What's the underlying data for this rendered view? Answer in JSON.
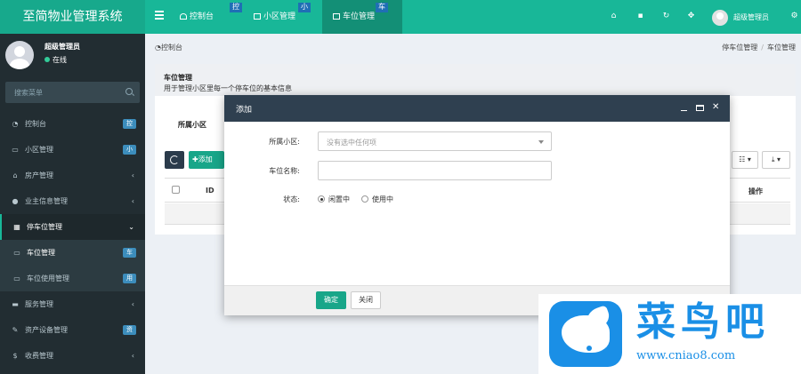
{
  "app_title": "至简物业管理系统",
  "top_tabs": [
    {
      "label": "控制台",
      "badge": "控",
      "icon": "dashboard-icon"
    },
    {
      "label": "小区管理",
      "badge": "小",
      "icon": "list-icon"
    },
    {
      "label": "车位管理",
      "badge": "车",
      "icon": "list-icon"
    }
  ],
  "top_user": "超级管理员",
  "top_icons": [
    "home-icon",
    "trash-icon",
    "refresh-icon",
    "fullscreen-icon",
    "settings-icon"
  ],
  "sidebar": {
    "user_name": "超级管理员",
    "status": "在线",
    "search_placeholder": "搜索菜单",
    "items": [
      {
        "label": "控制台",
        "badge": "控",
        "icon": "dashboard-icon"
      },
      {
        "label": "小区管理",
        "badge": "小",
        "icon": "list-icon"
      },
      {
        "label": "房产管理",
        "icon": "home-icon"
      },
      {
        "label": "业主信息管理",
        "icon": "user-icon"
      },
      {
        "label": "停车位管理",
        "icon": "parking-icon"
      },
      {
        "label": "车位管理",
        "badge": "车",
        "icon": "list-icon"
      },
      {
        "label": "车位使用管理",
        "badge": "用",
        "icon": "list-icon"
      },
      {
        "label": "服务管理",
        "icon": "book-icon"
      },
      {
        "label": "资产设备管理",
        "badge": "资",
        "icon": "wrench-icon"
      },
      {
        "label": "收费管理",
        "icon": "dollar-icon"
      }
    ]
  },
  "breadcrumb": {
    "left": "控制台",
    "right": [
      "停车位管理",
      "车位管理"
    ]
  },
  "panel": {
    "title": "车位管理",
    "desc": "用于管理小区里每一个停车位的基本信息",
    "tab_label": "所属小区",
    "add_label": "✚添加",
    "columns_btn": "☷ ▾",
    "export_btn": "⤓ ▾",
    "table_headers": {
      "id": "ID",
      "op": "操作"
    }
  },
  "modal": {
    "title": "添加",
    "fields": {
      "community_label": "所属小区:",
      "community_value": "没有选中任何项",
      "name_label": "车位名称:",
      "name_value": "",
      "status_label": "状态:",
      "status_options": [
        "闲置中",
        "使用中"
      ],
      "status_selected": "闲置中"
    },
    "ok_label": "确定",
    "close_label": "关闭"
  },
  "watermark": {
    "brand": "菜鸟吧",
    "url": "www.cniao8.com"
  },
  "colors": {
    "topbar": "#18b798",
    "sidebar": "#222d32",
    "badge": "#3c8dbc",
    "modal_head": "#2f4050",
    "primary_btn": "#18a689"
  }
}
